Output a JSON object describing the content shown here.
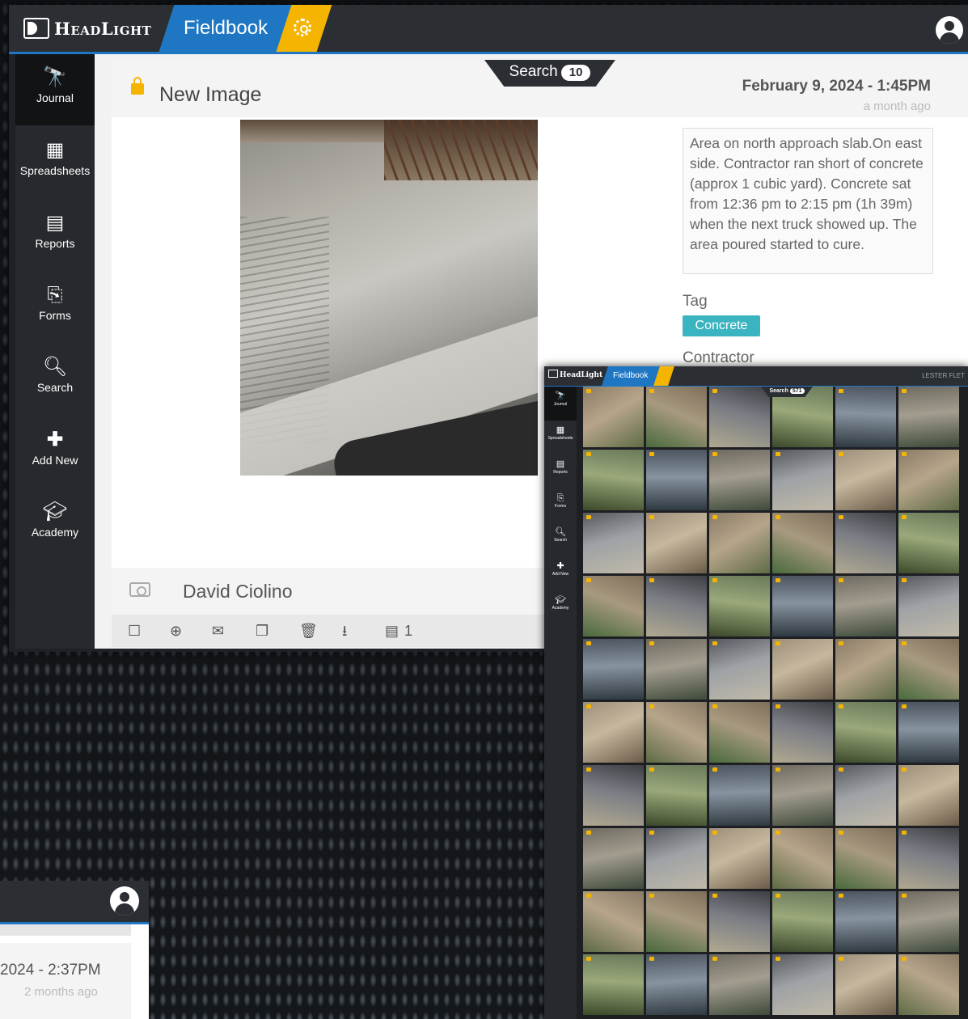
{
  "app": {
    "brand": "HeadLight",
    "section": "Fieldbook"
  },
  "sidebar": {
    "items": [
      {
        "label": "Journal",
        "icon": "binoculars-icon"
      },
      {
        "label": "Spreadsheets",
        "icon": "table-icon"
      },
      {
        "label": "Reports",
        "icon": "book-icon"
      },
      {
        "label": "Forms",
        "icon": "forms-icon"
      },
      {
        "label": "Search",
        "icon": "search-icon"
      },
      {
        "label": "Add New",
        "icon": "plus-icon"
      },
      {
        "label": "Academy",
        "icon": "graduation-cap-icon"
      }
    ]
  },
  "search": {
    "label": "Search",
    "count": "10"
  },
  "entry": {
    "title": "New Image",
    "date": "February 9, 2024 - 1:45PM",
    "relative": "a month ago",
    "note": "Area on north approach slab.On east side. Contractor ran short of concrete (approx 1 cubic yard). Concrete sat from 12:36 pm to 2:15 pm (1h 39m) when the next truck showed up. The area poured started to cure.",
    "tag_label": "Tag",
    "tag": "Concrete",
    "contractor_label": "Contractor",
    "author": "David Ciolino",
    "attachments": "1"
  },
  "toolbar": [
    "checkbox-icon",
    "zoom-in-icon",
    "email-icon",
    "copy-icon",
    "trash-icon",
    "download-icon",
    "book-icon"
  ],
  "grid_window": {
    "brand": "HeadLight",
    "section": "Fieldbook",
    "user": "LESTER FLET",
    "search_label": "Search",
    "search_count": "571",
    "nav": [
      "Journal",
      "Spreadsheets",
      "Reports",
      "Forms",
      "Search",
      "Add New",
      "Academy"
    ]
  },
  "secondary": {
    "date": "2024 - 2:37PM",
    "relative": "2 months ago"
  },
  "colors": {
    "accent": "#1f77c4",
    "gear": "#f5b400",
    "tag": "#3bb4c1",
    "topbar": "#2b2e33"
  }
}
